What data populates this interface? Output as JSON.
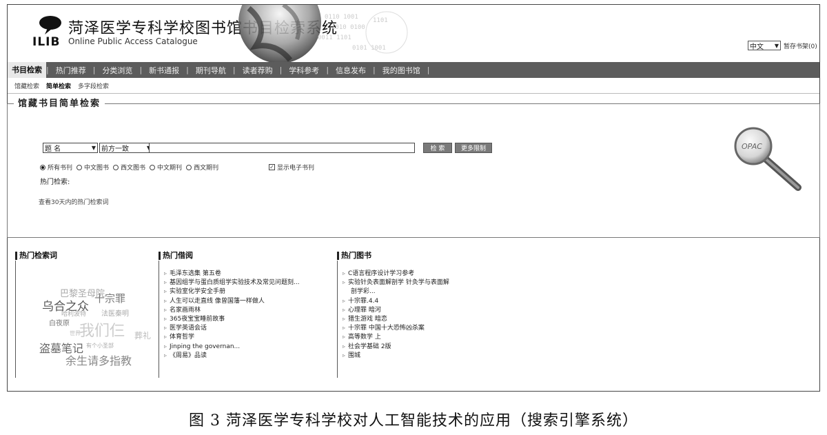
{
  "header": {
    "title_cn": "菏泽医学专科学校图书馆书目检索系统",
    "logo_text": "ILIB",
    "title_en": "Online Public Access Catalogue",
    "lang_selected": "中文",
    "cart_link": "暂存书架(0) |"
  },
  "nav": {
    "items": [
      "书目检索",
      "热门推荐",
      "分类浏览",
      "新书通报",
      "期刊导航",
      "读者荐购",
      "学科参考",
      "信息发布",
      "我的图书馆"
    ],
    "separator": "|"
  },
  "subnav": {
    "items": [
      "馆藏检索",
      "简单检索",
      "多字段检索"
    ]
  },
  "search": {
    "legend": "馆藏书目简单检索",
    "field_select": "题 名",
    "match_select": "前方一致",
    "query_value": "",
    "search_button": "检 索",
    "more_button": "更多限制",
    "radios": [
      "所有书刊",
      "中文图书",
      "西文图书",
      "中文期刊",
      "西文期刊"
    ],
    "checkbox_label": "显示电子书刊",
    "hot_label": "热门检索:",
    "hot_30_link": "查看30天内的热门检索词",
    "opac_label": "OPAC"
  },
  "hot_terms": {
    "title": "热门检索词",
    "words": [
      "巴黎圣母院",
      "乌合之众",
      "十宗罪",
      "哈利波特",
      "法医秦明",
      "白夜原",
      "我们仨",
      "葬礼",
      "盗墓笔记",
      "余生请多指教",
      "有个小圣部",
      "世界"
    ]
  },
  "hot_borrow": {
    "title": "热门借阅",
    "items": [
      "毛泽东选集 第五卷",
      "基因组学与蛋白质组学实验技术及常见问题刻...",
      "实验室化学安全手册",
      "人生可以走直线 像曾国藩一样做人",
      "名家画雨林",
      "365夜宝宝睡前故事",
      "医学英语会话",
      "体育哲学",
      "Jinping the governan...",
      "《周易》品读"
    ]
  },
  "hot_books": {
    "title": "热门图书",
    "items": [
      "C语言程序设计学习参考",
      "实验针灸表面解剖学 针灸学与表面解",
      "剖学彩...",
      "十宗罪.4.4",
      "心理罪 暗河",
      "猎生游戏 暗恋",
      "十宗罪 中国十大恐怖凶杀案",
      "高等数学 上",
      "社会学基础 2版",
      "围城"
    ]
  },
  "caption": "图 3   菏泽医学专科学校对人工智能技术的应用（搜索引擎系统）"
}
